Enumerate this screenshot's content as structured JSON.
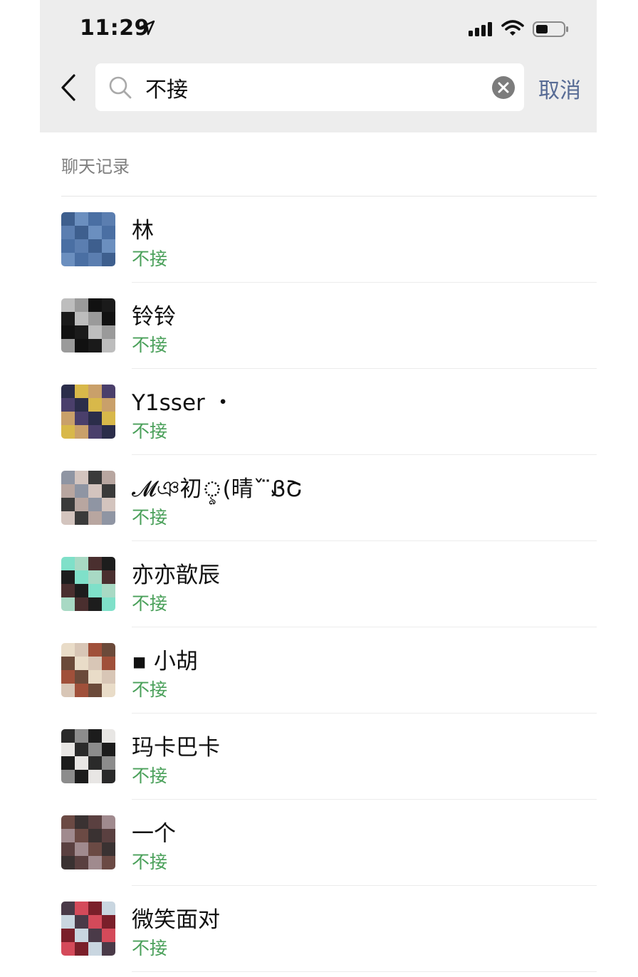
{
  "status_bar": {
    "time": "11:29"
  },
  "search": {
    "query": "不接",
    "cancel_label": "取消"
  },
  "section": {
    "title": "聊天记录"
  },
  "results": [
    {
      "name": "林",
      "snippet": "不接",
      "avatar_colors": [
        "#3e5f8e",
        "#5b7eb0",
        "#4a6fa3",
        "#6b8fbf"
      ]
    },
    {
      "name": "铃铃",
      "snippet": "不接",
      "avatar_colors": [
        "#bdbdbd",
        "#1a1a1a",
        "#111111",
        "#9a9a9a"
      ]
    },
    {
      "name": "Y1sser ・",
      "snippet": "不接",
      "avatar_colors": [
        "#2b2d4a",
        "#4a3f6b",
        "#c9a06a",
        "#d8b84a"
      ]
    },
    {
      "name": "𝓜ঞ初ৢ(晴ˇ ̈ᏰՇ",
      "snippet": "不接",
      "avatar_colors": [
        "#8f95a3",
        "#b8a6a0",
        "#3a3a3a",
        "#d3c4be"
      ]
    },
    {
      "name": "亦亦歆辰",
      "snippet": "不接",
      "avatar_colors": [
        "#7fe0c9",
        "#1d1d1d",
        "#4a2f2f",
        "#a8d9c4"
      ]
    },
    {
      "name": "▪ 小胡",
      "snippet": "不接",
      "avatar_colors": [
        "#e9dcc8",
        "#6b4a3a",
        "#a0503a",
        "#d8c6b6"
      ]
    },
    {
      "name": "玛卡巴卡",
      "snippet": "不接",
      "avatar_colors": [
        "#2a2a2a",
        "#e8e6e4",
        "#1c1c1c",
        "#8c8c8c"
      ]
    },
    {
      "name": "一个",
      "snippet": "不接",
      "avatar_colors": [
        "#6b4a44",
        "#a08a8e",
        "#5a4040",
        "#3a3232"
      ]
    },
    {
      "name": "微笑面对",
      "snippet": "不接",
      "avatar_colors": [
        "#4a3a48",
        "#c9d6e0",
        "#7a1f2a",
        "#d44a5a"
      ]
    }
  ]
}
